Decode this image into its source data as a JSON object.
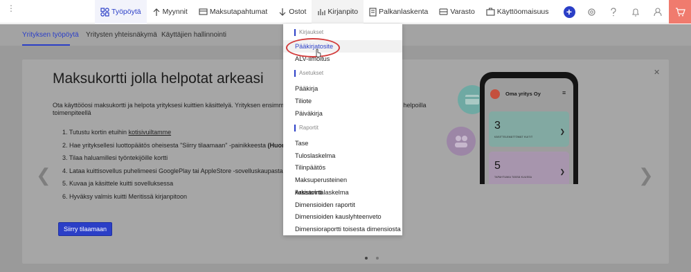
{
  "topnav": {
    "items": [
      {
        "label": "Työpöytä",
        "icon": "dashboard-icon",
        "active": true
      },
      {
        "label": "Myynnit",
        "icon": "arrow-up-icon"
      },
      {
        "label": "Maksutapahtumat",
        "icon": "card-icon"
      },
      {
        "label": "Ostot",
        "icon": "arrow-down-icon"
      },
      {
        "label": "Kirjanpito",
        "icon": "bar-chart-icon",
        "open": true
      },
      {
        "label": "Palkanlaskenta",
        "icon": "document-icon"
      },
      {
        "label": "Varasto",
        "icon": "warehouse-icon"
      },
      {
        "label": "Käyttöomaisuus",
        "icon": "briefcase-icon"
      }
    ],
    "icons": [
      "add-icon",
      "settings-icon",
      "help-icon",
      "bell-icon",
      "user-icon",
      "cart-icon"
    ],
    "accent": "#2b3fc7",
    "cart_bg": "#f07b6e"
  },
  "subtabs": [
    "Yrityksen työpöytä",
    "Yritysten yhteisnäkymä",
    "Käyttäjien hallinnointi"
  ],
  "promo": {
    "title": "Maksukortti jolla helpotat arkeasi",
    "text_left": "Ota käyttööosi maksukortti ja helpota yrityksesi kuittien käsittelyä. Yrityksen ensimmäinen ko",
    "text_right": "jolla helpoilla",
    "text_line2": "toimenpiteellä",
    "steps": [
      {
        "prefix": "1. Tutustu kortin etuihin ",
        "link": "kotisivuiltamme"
      },
      {
        "prefix": "2. Hae yrityksellesi luottopäätös oheisesta \"Siirry tilaamaan\" -painikkeesta ",
        "bold": "(Huom. Vain p"
      },
      {
        "prefix": "3. Tilaa haluamillesi työntekijöille kortti"
      },
      {
        "prefix": "4. Lataa kuittisovellus puhelimeesi GooglePlay tai AppleStore -sovelluskaupasta"
      },
      {
        "prefix": "5. Kuvaa ja käsittele kuitti sovelluksessa"
      },
      {
        "prefix": "6. Hyväksy valmis kuitti Meritissä kirjanpitoon"
      }
    ],
    "cta": "Siirry tilaamaan",
    "phone": {
      "company": "Oma yritys Oy",
      "tile1_num": "3",
      "tile1_label": "KÄSITTELEMÄTTÖMÄT KUITIT",
      "tile2_num": "5",
      "tile2_label": "TAPAHTUMIA TÄSSÄ KUUSSA"
    }
  },
  "dropdown": {
    "sections": [
      {
        "label": "Kirjaukset",
        "items": [
          "Pääkirjatosite",
          "ALV-ilmoitus"
        ]
      },
      {
        "label": "Asetukset",
        "items": [
          "Pääkirja",
          "Tiliote",
          "Päiväkirja"
        ]
      },
      {
        "label": "Raportit",
        "items": [
          "Tase",
          "Tuloslaskelma",
          "Tilinpäätös",
          "Maksuperusteinen kassavirtalaskelma",
          "Arkistointi",
          "Dimensioiden raportit",
          "Dimensioiden kauslyhteenveto",
          "Dimensioraportti toisesta dimensiosta"
        ]
      }
    ],
    "highlighted": "Pääkirjatosite"
  }
}
